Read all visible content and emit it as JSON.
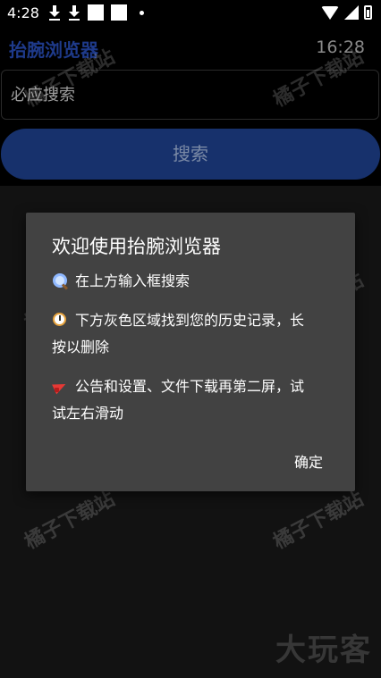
{
  "status_bar": {
    "time": "4:28"
  },
  "header": {
    "title": "抬腕浏览器",
    "clock": "16:28"
  },
  "search": {
    "placeholder": "必应搜索",
    "button_label": "搜索"
  },
  "dialog": {
    "title": "欢迎使用抬腕浏览器",
    "lines": [
      "在上方输入框搜索",
      "下方灰色区域找到您的历史记录，长按以删除",
      "公告和设置、文件下载再第二屏，试试左右滑动"
    ],
    "confirm_label": "确定"
  },
  "watermark": {
    "text": "橘子下载站"
  },
  "corner_logo": {
    "text": "大玩客"
  },
  "colors": {
    "title_blue": "#1e3a8a",
    "button_blue": "#17316c",
    "dialog_bg": "#424242",
    "history_bg": "#121212"
  }
}
